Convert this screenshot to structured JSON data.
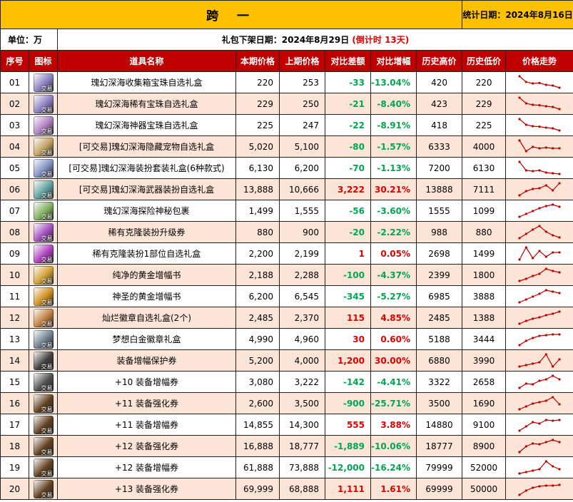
{
  "header": {
    "title": "跨 一",
    "stat_date": "统计日期：2024年8月16日",
    "unit": "单位：万",
    "release_date": "礼包下架日期：2024年8月29日",
    "countdown": "(倒计时 13天)"
  },
  "columns": [
    "序号",
    "图标",
    "道具名称",
    "本期价格",
    "上期价格",
    "对比差额",
    "对比增幅",
    "历史高价",
    "历史低价",
    "价格走势"
  ],
  "colors": {
    "title_bg": "#ffc000",
    "header_bg": "#c00000",
    "row_alt": "#fce4d6",
    "up": "#e00000",
    "down": "#00a650",
    "trend": "#c00000"
  },
  "rows": [
    {
      "no": "01",
      "icon": "box-icon",
      "icon_color": "#8a7fc0",
      "tag": "交易",
      "name": "瑰幻深海收集箱宝珠自选礼盒",
      "cur": "220",
      "prev": "253",
      "diff": "-33",
      "pct": "-13.04%",
      "high": "420",
      "low": "220",
      "trend": [
        0.95,
        0.55,
        0.45,
        0.48,
        0.35,
        0.3,
        0.15
      ]
    },
    {
      "no": "02",
      "icon": "box-icon",
      "icon_color": "#8a7fc0",
      "tag": "交易",
      "name": "瑰幻深海稀有宝珠自选礼盒",
      "cur": "229",
      "prev": "250",
      "diff": "-21",
      "pct": "-8.40%",
      "high": "423",
      "low": "229",
      "trend": [
        0.95,
        0.55,
        0.45,
        0.42,
        0.35,
        0.3,
        0.15
      ]
    },
    {
      "no": "03",
      "icon": "box-icon",
      "icon_color": "#b07fc0",
      "tag": "交易",
      "name": "瑰幻深海神器宝珠自选礼盒",
      "cur": "225",
      "prev": "247",
      "diff": "-22",
      "pct": "-8.91%",
      "high": "418",
      "low": "225",
      "trend": [
        0.95,
        0.55,
        0.45,
        0.42,
        0.35,
        0.3,
        0.15
      ]
    },
    {
      "no": "04",
      "icon": "box-icon",
      "icon_color": "#c0a060",
      "tag": "交易",
      "name": "[可交易]瑰幻深海隐藏宠物自选礼盒",
      "cur": "5,020",
      "prev": "5,100",
      "diff": "-80",
      "pct": "-1.57%",
      "high": "6333",
      "low": "4000",
      "trend": [
        0.95,
        0.2,
        0.5,
        0.4,
        0.45,
        0.4,
        0.4
      ]
    },
    {
      "no": "05",
      "icon": "box-icon",
      "icon_color": "#7f8fc0",
      "tag": "交易",
      "name": "[可交易]瑰幻深海装扮套装礼盒(6种款式)",
      "cur": "6,130",
      "prev": "6,200",
      "diff": "-70",
      "pct": "-1.13%",
      "high": "7200",
      "low": "6130",
      "trend": [
        0.95,
        0.35,
        0.3,
        0.35,
        0.2,
        0.15,
        0.1
      ]
    },
    {
      "no": "06",
      "icon": "box-icon",
      "icon_color": "#60a0a0",
      "tag": "交易",
      "name": "[可交易]瑰幻深海武器装扮自选礼盒",
      "cur": "13,888",
      "prev": "10,666",
      "diff": "3,222",
      "pct": "30.21%",
      "high": "13888",
      "low": "7111",
      "trend": [
        0.1,
        0.4,
        0.55,
        0.6,
        0.8,
        0.45,
        0.95
      ]
    },
    {
      "no": "07",
      "icon": "box-icon",
      "icon_color": "#80b060",
      "tag": "交易",
      "name": "瑰幻深海探险神秘包裹",
      "cur": "1,499",
      "prev": "1,555",
      "diff": "-56",
      "pct": "-3.60%",
      "high": "1555",
      "low": "1099",
      "trend": [
        0.1,
        0.3,
        0.5,
        0.7,
        0.85,
        0.95,
        0.8
      ]
    },
    {
      "no": "08",
      "icon": "ticket-icon",
      "icon_color": "#a050c0",
      "tag": "交易",
      "name": "稀有克隆装扮升级券",
      "cur": "880",
      "prev": "900",
      "diff": "-20",
      "pct": "-2.22%",
      "high": "988",
      "low": "880",
      "trend": [
        0.1,
        0.4,
        0.7,
        0.95,
        0.55,
        0.3,
        0.15
      ]
    },
    {
      "no": "09",
      "icon": "ticket-icon",
      "icon_color": "#b040c0",
      "tag": "交易",
      "name": "稀有克隆装扮1部位自选礼盒",
      "cur": "2,200",
      "prev": "2,199",
      "diff": "1",
      "pct": "0.05%",
      "high": "2698",
      "low": "1499",
      "trend": [
        0.1,
        0.95,
        0.2,
        0.7,
        0.3,
        0.6,
        0.6
      ]
    },
    {
      "no": "10",
      "icon": "book-icon",
      "icon_color": "#d0a030",
      "tag": "交易",
      "name": "纯净的黄金增幅书",
      "cur": "2,188",
      "prev": "2,288",
      "diff": "-100",
      "pct": "-4.37%",
      "high": "2399",
      "low": "1800",
      "trend": [
        0.1,
        0.25,
        0.45,
        0.6,
        0.95,
        0.8,
        0.7
      ]
    },
    {
      "no": "11",
      "icon": "book-icon",
      "icon_color": "#d09020",
      "tag": "交易",
      "name": "神圣的黄金增幅书",
      "cur": "6,200",
      "prev": "6,545",
      "diff": "-345",
      "pct": "-5.27%",
      "high": "6985",
      "low": "3888",
      "trend": [
        0.1,
        0.3,
        0.5,
        0.7,
        0.95,
        0.85,
        0.75
      ]
    },
    {
      "no": "12",
      "icon": "badge-icon",
      "icon_color": "#c08040",
      "tag": "交易",
      "name": "灿烂徽章自选礼盒(2个)",
      "cur": "2,485",
      "prev": "2,370",
      "diff": "115",
      "pct": "4.85%",
      "high": "2485",
      "low": "1388",
      "trend": [
        0.1,
        0.3,
        0.45,
        0.55,
        0.7,
        0.8,
        0.95
      ]
    },
    {
      "no": "13",
      "icon": "badge-icon",
      "icon_color": "#708090",
      "tag": "交易",
      "name": "梦想白金徽章礼盒",
      "cur": "4,990",
      "prev": "4,960",
      "diff": "30",
      "pct": "0.60%",
      "high": "5188",
      "low": "3444",
      "trend": [
        0.1,
        0.4,
        0.6,
        0.75,
        0.8,
        0.85,
        0.85
      ]
    },
    {
      "no": "14",
      "icon": "hammer-icon",
      "icon_color": "#404040",
      "tag": "交易",
      "name": "装备增幅保护券",
      "cur": "5,200",
      "prev": "4,000",
      "diff": "1,200",
      "pct": "30.00%",
      "high": "6880",
      "low": "3990",
      "trend": [
        0.1,
        0.2,
        0.3,
        0.4,
        0.95,
        0.1,
        0.6
      ]
    },
    {
      "no": "15",
      "icon": "scroll-icon",
      "icon_color": "#505050",
      "tag": "交易",
      "name": "+10 装备增幅券",
      "cur": "3,080",
      "prev": "3,222",
      "diff": "-142",
      "pct": "-4.41%",
      "high": "3322",
      "low": "2658",
      "trend": [
        0.1,
        0.4,
        0.35,
        0.6,
        0.7,
        0.95,
        0.7
      ]
    },
    {
      "no": "16",
      "icon": "scroll-icon",
      "icon_color": "#604020",
      "tag": "交易",
      "name": "+11 装备强化券",
      "cur": "2,600",
      "prev": "3,500",
      "diff": "-900",
      "pct": "-25.71%",
      "high": "3500",
      "low": "1690",
      "trend": [
        0.1,
        0.3,
        0.5,
        0.6,
        0.7,
        0.95,
        0.45
      ]
    },
    {
      "no": "17",
      "icon": "scroll-icon",
      "icon_color": "#604020",
      "tag": "交易",
      "name": "+11 装备增幅券",
      "cur": "14,855",
      "prev": "14,300",
      "diff": "555",
      "pct": "3.88%",
      "high": "14880",
      "low": "9100",
      "trend": [
        0.1,
        0.4,
        0.7,
        0.6,
        0.85,
        0.8,
        0.85
      ]
    },
    {
      "no": "18",
      "icon": "scroll-icon",
      "icon_color": "#604020",
      "tag": "交易",
      "name": "+12 装备强化券",
      "cur": "16,888",
      "prev": "18,777",
      "diff": "-1,889",
      "pct": "-10.06%",
      "high": "18777",
      "low": "8900",
      "trend": [
        0.1,
        0.5,
        0.7,
        0.65,
        0.8,
        0.95,
        0.8
      ]
    },
    {
      "no": "19",
      "icon": "scroll-icon",
      "icon_color": "#604020",
      "tag": "交易",
      "name": "+12 装备增幅券",
      "cur": "61,888",
      "prev": "73,888",
      "diff": "-12,000",
      "pct": "-16.24%",
      "high": "79999",
      "low": "52000",
      "trend": [
        0.1,
        0.2,
        0.3,
        0.4,
        0.95,
        0.6,
        0.4
      ]
    },
    {
      "no": "20",
      "icon": "scroll-icon",
      "icon_color": "#604020",
      "tag": "交易",
      "name": "+13 装备强化券",
      "cur": "69,999",
      "prev": "68,888",
      "diff": "1,111",
      "pct": "1.61%",
      "high": "69999",
      "low": "50000",
      "trend": [
        0.1,
        0.4,
        0.6,
        0.7,
        0.75,
        0.75,
        0.8
      ]
    }
  ]
}
